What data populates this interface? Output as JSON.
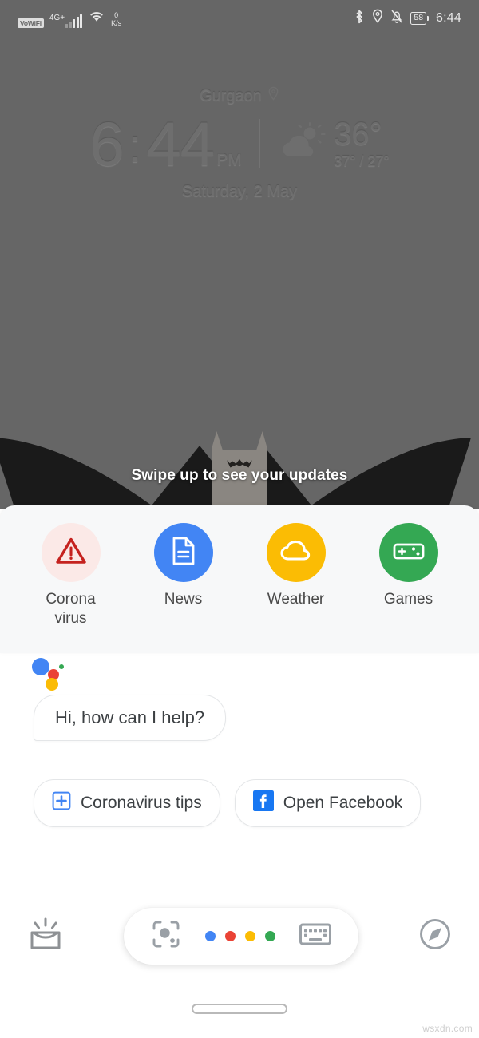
{
  "status_bar": {
    "vowifi_label": "VoWiFi",
    "network_label": "4G+",
    "data_rate_value": "0",
    "data_rate_unit": "K/s",
    "bluetooth_icon": "bluetooth-icon",
    "location_icon": "location-pin-icon",
    "silent_icon": "bell-muted-icon",
    "battery_level": "58",
    "time": "6:44"
  },
  "clock_widget": {
    "city": "Gurgaon",
    "location_icon": "location-pin-icon",
    "hour": "6",
    "colon": ":",
    "minute": "44",
    "ampm": "PM",
    "weather_icon": "partly-cloudy-icon",
    "temperature": "36°",
    "temperature_range": "37° / 27°",
    "date": "Saturday, 2 May"
  },
  "wallpaper": {
    "swipe_hint": "Swipe up to see your updates"
  },
  "shortcuts": {
    "items": [
      {
        "label": "Corona\nvirus",
        "label_line1": "Corona",
        "label_line2": "virus",
        "icon": "warning-triangle-icon",
        "circle_color": "#FBE9E7",
        "icon_color": "#C5221F"
      },
      {
        "label": "News",
        "icon": "document-icon",
        "circle_color": "#4285F4",
        "icon_color": "#FFFFFF"
      },
      {
        "label": "Weather",
        "icon": "cloud-icon",
        "circle_color": "#FBBC04",
        "icon_color": "#FFFFFF"
      },
      {
        "label": "Games",
        "icon": "gamepad-icon",
        "circle_color": "#34A853",
        "icon_color": "#FFFFFF"
      }
    ]
  },
  "assistant": {
    "logo_icon": "google-assistant-icon",
    "greeting": "Hi, how can I help?",
    "chips": [
      {
        "label": "Coronavirus tips",
        "icon": "medical-cross-icon",
        "icon_color": "#4285F4"
      },
      {
        "label": "Open Facebook",
        "icon": "facebook-icon",
        "icon_color": "#1877F2"
      }
    ]
  },
  "bottom_bar": {
    "updates_icon": "inbox-sparkle-icon",
    "lens_icon": "google-lens-icon",
    "keyboard_icon": "keyboard-icon",
    "explore_icon": "compass-icon",
    "mic_dot_colors": [
      "#4285F4",
      "#EA4335",
      "#FBBC04",
      "#34A853"
    ]
  },
  "navigation": {
    "gesture_pill": "home-gesture-pill"
  },
  "watermark": "wsxdn.com",
  "colors": {
    "wallpaper_gray": "#666666",
    "panel_bg": "#F7F8F9",
    "text_primary": "#3C4043",
    "google_blue": "#4285F4",
    "google_red": "#EA4335",
    "google_yellow": "#FBBC04",
    "google_green": "#34A853"
  }
}
